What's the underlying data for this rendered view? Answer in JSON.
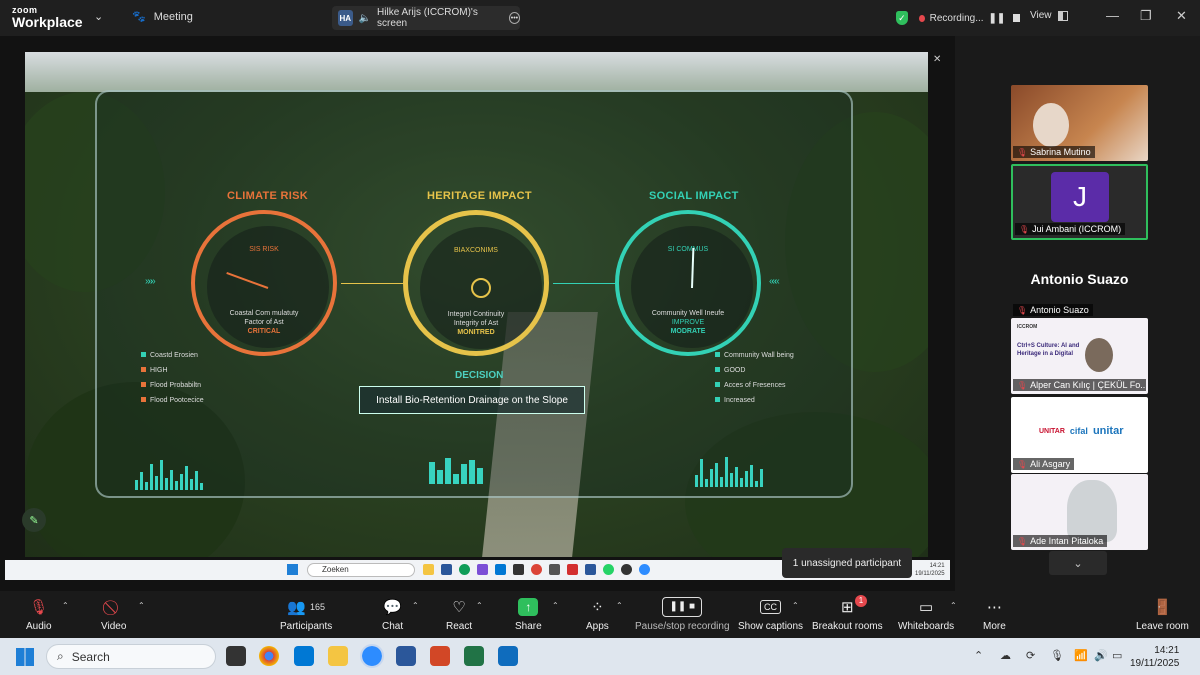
{
  "topbar": {
    "brand_small": "zoom",
    "brand_large": "Workplace",
    "meeting_label": "Meeting",
    "share_initials": "HA",
    "share_label": "Hilke Arijs (ICCROM)'s screen",
    "recording_label": "Recording...",
    "view_label": "View"
  },
  "slide": {
    "gauges": [
      {
        "title": "CLIMATE RISK",
        "top_text": "SIS RISK",
        "line1": "Coastal Com mulatuty",
        "line2": "Factor of Ast",
        "status": "CRITICAL",
        "color": "#e8733a"
      },
      {
        "title": "HERITAGE IMPACT",
        "top_text": "BIAXCONIMS",
        "line1": "Integrol Continuity",
        "line2": "Integrity of Ast",
        "status": "MONITRED",
        "color": "#e6c34a"
      },
      {
        "title": "SOCIAL IMPACT",
        "top_text": "SI COMMUS",
        "line1": "Community Well Ineufe",
        "line2": "IMPROVE",
        "status": "MODRATE",
        "color": "#33d1b5"
      }
    ],
    "left_list": [
      "Coastd Erosien",
      "HIGH",
      "Flood Probabiltn",
      "Flood Pootcecice"
    ],
    "right_list": [
      "Community Wall being",
      "GOOD",
      "Acces of Fresences",
      "Increased"
    ],
    "decision_title": "DECISION",
    "decision_text": "Install Bio-Retention Drainage on the Slope"
  },
  "remote_taskbar": {
    "search": "Zoeken",
    "time": "14:21",
    "date": "19/11/2025"
  },
  "tooltip": "1 unassigned participant",
  "participants_panel": {
    "tiles": [
      {
        "name": "Sabrina Mutino"
      },
      {
        "name": "Jui Ambani (ICCROM)",
        "initial": "J"
      },
      {
        "name": "Antonio Suazo"
      },
      {
        "name": "Alper Can Kılıç | ÇEKÜL Fo..."
      },
      {
        "name": "Ali Asgary"
      },
      {
        "name": "Ade Intan Pitaloka"
      }
    ],
    "featured_name": "Antonio Suazo",
    "slide_org": "ICCROM",
    "slide_heading": "Ctrl+S Culture: AI and Heritage in a Digital",
    "logos": [
      "UNITAR",
      "cifal",
      "unitar"
    ]
  },
  "toolbar": {
    "audio": "Audio",
    "video": "Video",
    "participants": "Participants",
    "participants_count": "165",
    "chat": "Chat",
    "react": "React",
    "share": "Share",
    "apps": "Apps",
    "pause_recording": "Pause/stop recording",
    "captions": "Show captions",
    "captions_icon_text": "CC",
    "breakout": "Breakout rooms",
    "breakout_badge": "1",
    "whiteboards": "Whiteboards",
    "more": "More",
    "leave": "Leave room"
  },
  "windows_taskbar": {
    "search": "Search",
    "time": "14:21",
    "date": "19/11/2025"
  }
}
